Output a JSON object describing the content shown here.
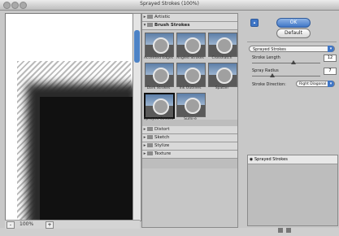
{
  "window": {
    "title": "Sprayed Strokes (100%)"
  },
  "preview": {
    "zoom": "100%",
    "minus": "-",
    "plus": "+"
  },
  "filters": {
    "categories": [
      {
        "label": "Artistic",
        "expanded": false
      },
      {
        "label": "Brush Strokes",
        "expanded": true
      },
      {
        "label": "Distort",
        "expanded": false
      },
      {
        "label": "Sketch",
        "expanded": false
      },
      {
        "label": "Stylize",
        "expanded": false
      },
      {
        "label": "Texture",
        "expanded": false
      }
    ],
    "brush_strokes": [
      {
        "label": "Accented Edges"
      },
      {
        "label": "Angled Strokes"
      },
      {
        "label": "Crosshatch"
      },
      {
        "label": "Dark Strokes"
      },
      {
        "label": "Ink Outlines"
      },
      {
        "label": "Spatter"
      },
      {
        "label": "Sprayed Strokes",
        "selected": true
      },
      {
        "label": "Sumi-e"
      }
    ]
  },
  "settings": {
    "ok_label": "OK",
    "default_label": "Default",
    "filter_select": "Sprayed Strokes",
    "params": [
      {
        "label": "Stroke Length",
        "value": "12",
        "fraction": 0.6
      },
      {
        "label": "Spray Radius",
        "value": "7",
        "fraction": 0.28
      }
    ],
    "direction_label": "Stroke Direction:",
    "direction_value": "Right Diagonal",
    "layers": [
      {
        "label": "Sprayed Strokes",
        "visible": true
      }
    ]
  },
  "colors": {
    "accent": "#3f76c6",
    "panel": "#c8c8c8"
  }
}
